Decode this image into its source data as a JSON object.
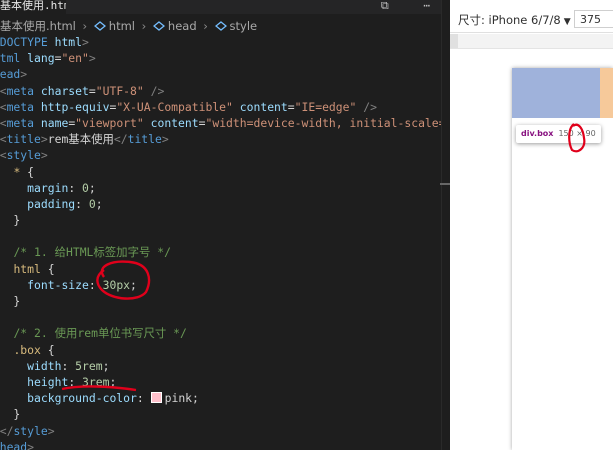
{
  "editor": {
    "tab_title": "基本使用.html",
    "tab_actions": "⧉ ⋯",
    "breadcrumb": {
      "file": "基本使用.html",
      "html": "html",
      "head": "head",
      "style": "style"
    },
    "lines": [
      [
        [
          "p",
          "<!"
        ],
        [
          "t",
          "DOCTYPE"
        ],
        [
          "w",
          " "
        ],
        [
          "a",
          "html"
        ],
        [
          "p",
          ">"
        ]
      ],
      [
        [
          "p",
          "<"
        ],
        [
          "t",
          "html"
        ],
        [
          "w",
          " "
        ],
        [
          "a",
          "lang"
        ],
        [
          "w",
          "="
        ],
        [
          "s",
          "\"en\""
        ],
        [
          "p",
          ">"
        ]
      ],
      [
        [
          "p",
          "<"
        ],
        [
          "t",
          "head"
        ],
        [
          "p",
          ">"
        ]
      ],
      [
        [
          "w",
          "  "
        ],
        [
          "p",
          "<"
        ],
        [
          "t",
          "meta"
        ],
        [
          "w",
          " "
        ],
        [
          "a",
          "charset"
        ],
        [
          "w",
          "="
        ],
        [
          "s",
          "\"UTF-8\""
        ],
        [
          "w",
          " "
        ],
        [
          "p",
          "/>"
        ]
      ],
      [
        [
          "w",
          "  "
        ],
        [
          "p",
          "<"
        ],
        [
          "t",
          "meta"
        ],
        [
          "w",
          " "
        ],
        [
          "a",
          "http-equiv"
        ],
        [
          "w",
          "="
        ],
        [
          "s",
          "\"X-UA-Compatible\""
        ],
        [
          "w",
          " "
        ],
        [
          "a",
          "content"
        ],
        [
          "w",
          "="
        ],
        [
          "s",
          "\"IE=edge\""
        ],
        [
          "w",
          " "
        ],
        [
          "p",
          "/>"
        ]
      ],
      [
        [
          "w",
          "  "
        ],
        [
          "p",
          "<"
        ],
        [
          "t",
          "meta"
        ],
        [
          "w",
          " "
        ],
        [
          "a",
          "name"
        ],
        [
          "w",
          "="
        ],
        [
          "s",
          "\"viewport\""
        ],
        [
          "w",
          " "
        ],
        [
          "a",
          "content"
        ],
        [
          "w",
          "="
        ],
        [
          "s",
          "\"width=device-width, initial-scale=1.0\""
        ]
      ],
      [
        [
          "w",
          "  "
        ],
        [
          "p",
          "<"
        ],
        [
          "t",
          "title"
        ],
        [
          "p",
          ">"
        ],
        [
          "w",
          "rem基本使用"
        ],
        [
          "p",
          "</"
        ],
        [
          "t",
          "title"
        ],
        [
          "p",
          ">"
        ]
      ],
      [
        [
          "w",
          "  "
        ],
        [
          "p",
          "<"
        ],
        [
          "t",
          "style"
        ],
        [
          "p",
          ">"
        ]
      ],
      [
        [
          "w",
          "    "
        ],
        [
          "sel",
          "*"
        ],
        [
          "w",
          " {"
        ]
      ],
      [
        [
          "w",
          "      "
        ],
        [
          "a",
          "margin"
        ],
        [
          "w",
          ": "
        ],
        [
          "n",
          "0"
        ],
        [
          "w",
          ";"
        ]
      ],
      [
        [
          "w",
          "      "
        ],
        [
          "a",
          "padding"
        ],
        [
          "w",
          ": "
        ],
        [
          "n",
          "0"
        ],
        [
          "w",
          ";"
        ]
      ],
      [
        [
          "w",
          "    }"
        ]
      ],
      [
        [
          "w",
          ""
        ]
      ],
      [
        [
          "w",
          "    "
        ],
        [
          "c",
          "/* 1. 给HTML标签加字号 */"
        ]
      ],
      [
        [
          "w",
          "    "
        ],
        [
          "sel",
          "html"
        ],
        [
          "w",
          " {"
        ]
      ],
      [
        [
          "w",
          "      "
        ],
        [
          "a",
          "font-size"
        ],
        [
          "w",
          ": "
        ],
        [
          "n",
          "30px"
        ],
        [
          "w",
          ";"
        ]
      ],
      [
        [
          "w",
          "    }"
        ]
      ],
      [
        [
          "w",
          ""
        ]
      ],
      [
        [
          "w",
          "    "
        ],
        [
          "c",
          "/* 2. 使用rem单位书写尺寸 */"
        ]
      ],
      [
        [
          "w",
          "    "
        ],
        [
          "sel",
          ".box"
        ],
        [
          "w",
          " {"
        ]
      ],
      [
        [
          "w",
          "      "
        ],
        [
          "a",
          "width"
        ],
        [
          "w",
          ": "
        ],
        [
          "n",
          "5rem"
        ],
        [
          "w",
          ";"
        ]
      ],
      [
        [
          "w",
          "      "
        ],
        [
          "a",
          "height"
        ],
        [
          "w",
          ": "
        ],
        [
          "n",
          "3rem"
        ],
        [
          "w",
          ";"
        ]
      ],
      [
        [
          "w",
          "      "
        ],
        [
          "a",
          "background-color"
        ],
        [
          "w",
          ": "
        ],
        [
          "swatch",
          ""
        ],
        [
          "w",
          "pink;"
        ]
      ],
      [
        [
          "w",
          "    }"
        ]
      ],
      [
        [
          "w",
          "  "
        ],
        [
          "p",
          "</"
        ],
        [
          "t",
          "style"
        ],
        [
          "p",
          ">"
        ]
      ],
      [
        [
          "p",
          "</"
        ],
        [
          "t",
          "head"
        ],
        [
          "p",
          ">"
        ]
      ]
    ]
  },
  "preview": {
    "device_label": "尺寸: iPhone 6/7/8",
    "device_caret": "▼",
    "width_value": "375",
    "inspect_tip": {
      "name": "div.box",
      "dims": "150 × 90"
    },
    "colors": {
      "box": "#9fb2db",
      "box_pink": "#ffc0cb"
    }
  },
  "annotations": {
    "pen_color": "#e0001b"
  }
}
